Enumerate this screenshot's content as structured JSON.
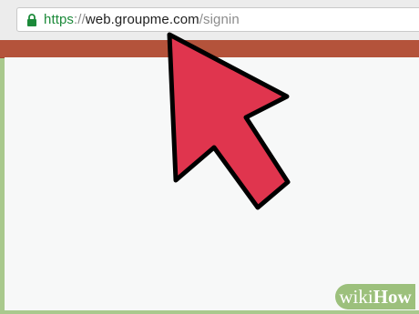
{
  "browser": {
    "url_scheme": "https",
    "url_separator": "://",
    "url_host": "web.groupme.com",
    "url_path": "/signin",
    "lock_icon": "lock-icon",
    "secure_color": "#1c8a3a"
  },
  "page": {
    "header_color": "#b4533b",
    "background_color": "#f7f8f8"
  },
  "annotation": {
    "arrow_icon": "pointer-arrow-icon",
    "arrow_color": "#e0354e"
  },
  "watermark": {
    "part_light": "wiki",
    "part_bold": "How"
  }
}
